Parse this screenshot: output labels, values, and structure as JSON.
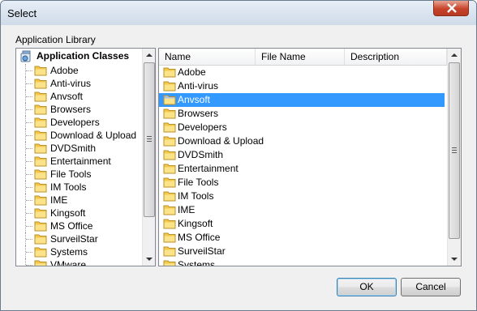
{
  "window": {
    "title": "Select"
  },
  "group": {
    "label": "Application Library"
  },
  "tree": {
    "root_label": "Application Classes",
    "items": [
      "Adobe",
      "Anti-virus",
      "Anvsoft",
      "Browsers",
      "Developers",
      "Download & Upload",
      "DVDSmith",
      "Entertainment",
      "File Tools",
      "IM Tools",
      "IME",
      "Kingsoft",
      "MS Office",
      "SurveilStar",
      "Systems",
      "VMware"
    ]
  },
  "list": {
    "columns": [
      "Name",
      "File Name",
      "Description"
    ],
    "rows": [
      "Adobe",
      "Anti-virus",
      "Anvsoft",
      "Browsers",
      "Developers",
      "Download & Upload",
      "DVDSmith",
      "Entertainment",
      "File Tools",
      "IM Tools",
      "IME",
      "Kingsoft",
      "MS Office",
      "SurveilStar",
      "Systems"
    ],
    "selected": "Anvsoft"
  },
  "buttons": {
    "ok": "OK",
    "cancel": "Cancel"
  },
  "colors": {
    "selection": "#3399ff",
    "folder": "#f2c94c",
    "close": "#c7432a"
  }
}
